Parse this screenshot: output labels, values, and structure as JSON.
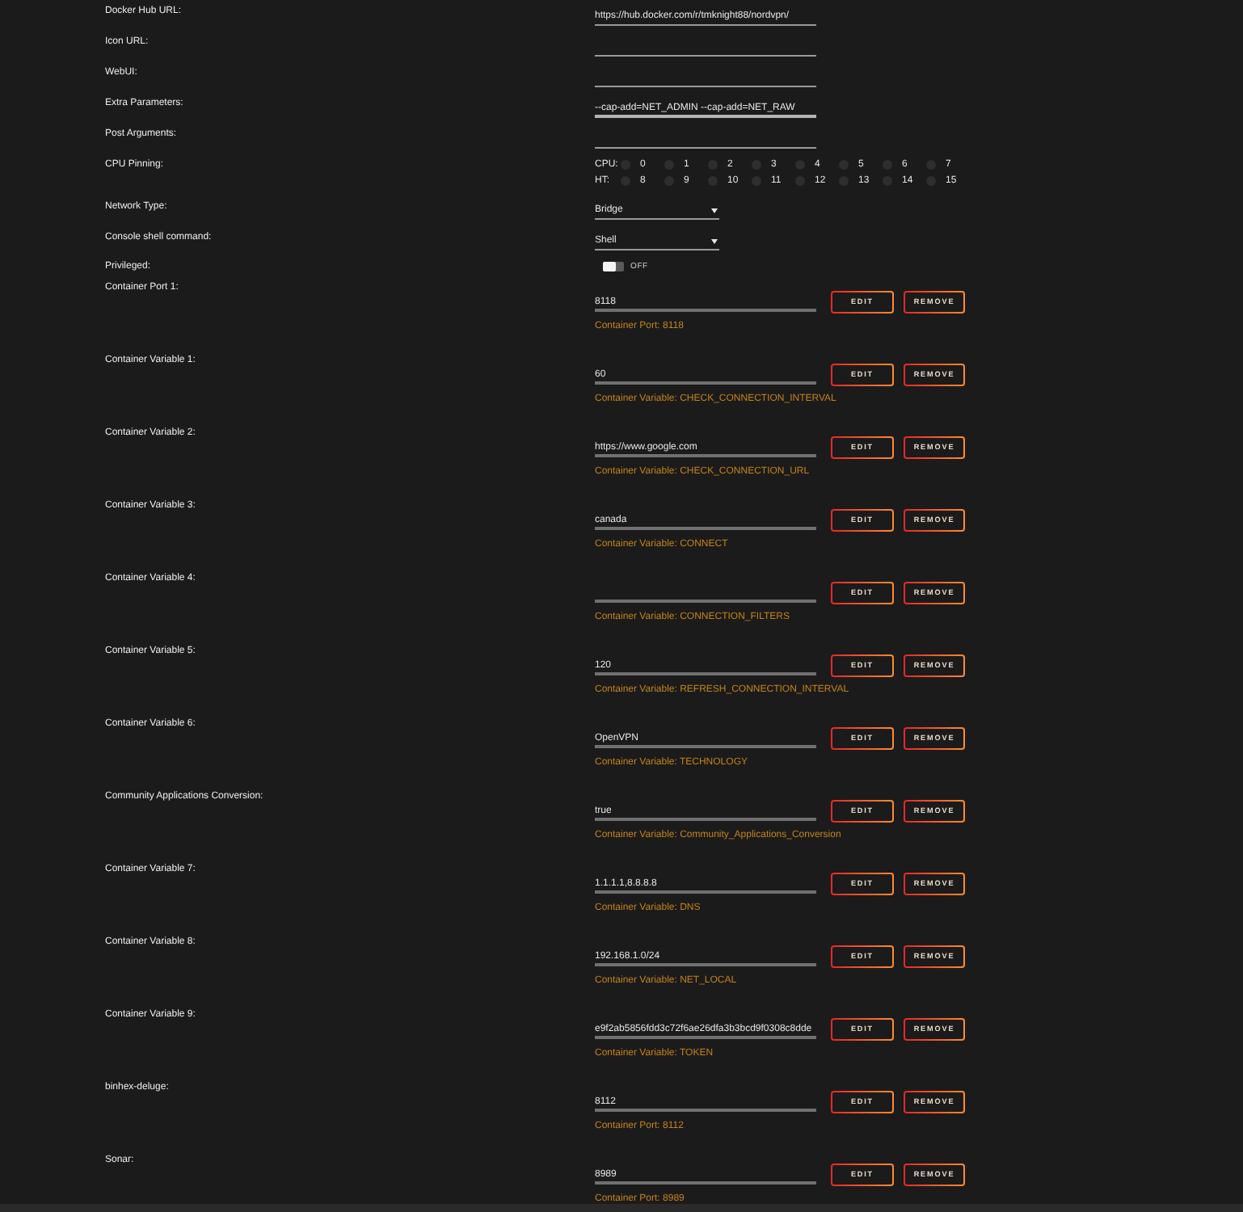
{
  "settings": [
    {
      "kind": "text",
      "label": "Docker Hub URL:",
      "value": "https://hub.docker.com/r/tmknight88/nordvpn/",
      "focused": false
    },
    {
      "kind": "text",
      "label": "Icon URL:",
      "focused": false
    },
    {
      "kind": "text",
      "label": "WebUI:",
      "focused": false
    },
    {
      "kind": "text",
      "label": "Extra Parameters:",
      "value": "--cap-add=NET_ADMIN --cap-add=NET_RAW",
      "focused": true
    },
    {
      "kind": "text",
      "label": "Post Arguments:",
      "focused": false
    },
    {
      "kind": "cpu",
      "label": "CPU Pinning:",
      "groups": [
        {
          "label": "CPU:",
          "cores": [
            {
              "number": "0",
              "checked": false
            },
            {
              "number": "1",
              "checked": false
            },
            {
              "number": "2",
              "checked": false
            },
            {
              "number": "3",
              "checked": false
            },
            {
              "number": "4",
              "checked": false
            },
            {
              "number": "5",
              "checked": false
            },
            {
              "number": "6",
              "checked": false
            },
            {
              "number": "7",
              "checked": false
            }
          ]
        },
        {
          "label": "HT:",
          "cores": [
            {
              "number": "8",
              "checked": false
            },
            {
              "number": "9",
              "checked": false
            },
            {
              "number": "10",
              "checked": false
            },
            {
              "number": "11",
              "checked": false
            },
            {
              "number": "12",
              "checked": false
            },
            {
              "number": "13",
              "checked": false
            },
            {
              "number": "14",
              "checked": false
            },
            {
              "number": "15",
              "checked": false
            }
          ]
        }
      ]
    },
    {
      "kind": "select",
      "label": "Network Type:",
      "value": "Bridge"
    },
    {
      "kind": "select",
      "label": "Console shell command:",
      "value": "Shell"
    },
    {
      "kind": "toggle",
      "label": "Privileged:",
      "on": false,
      "state_text": "OFF"
    }
  ],
  "mappings": [
    {
      "label": "Container Port 1:",
      "value": "8118",
      "edit": "EDIT",
      "remove": "REMOVE",
      "hint": "Container Port: 8118"
    },
    {
      "label": "Container Variable 1:",
      "value": "60",
      "edit": "EDIT",
      "remove": "REMOVE",
      "hint": "Container Variable: CHECK_CONNECTION_INTERVAL"
    },
    {
      "label": "Container Variable 2:",
      "value": "https://www.google.com",
      "edit": "EDIT",
      "remove": "REMOVE",
      "hint": "Container Variable: CHECK_CONNECTION_URL"
    },
    {
      "label": "Container Variable 3:",
      "value": "canada",
      "edit": "EDIT",
      "remove": "REMOVE",
      "hint": "Container Variable: CONNECT"
    },
    {
      "label": "Container Variable 4:",
      "edit": "EDIT",
      "remove": "REMOVE",
      "hint": "Container Variable: CONNECTION_FILTERS"
    },
    {
      "label": "Container Variable 5:",
      "value": "120",
      "edit": "EDIT",
      "remove": "REMOVE",
      "hint": "Container Variable: REFRESH_CONNECTION_INTERVAL"
    },
    {
      "label": "Container Variable 6:",
      "value": "OpenVPN",
      "edit": "EDIT",
      "remove": "REMOVE",
      "hint": "Container Variable: TECHNOLOGY"
    },
    {
      "label": "Community Applications Conversion:",
      "value": "true",
      "edit": "EDIT",
      "remove": "REMOVE",
      "hint": "Container Variable: Community_Applications_Conversion"
    },
    {
      "label": "Container Variable 7:",
      "value": "1.1.1.1,8.8.8.8",
      "edit": "EDIT",
      "remove": "REMOVE",
      "hint": "Container Variable: DNS"
    },
    {
      "label": "Container Variable 8:",
      "value": "192.168.1.0/24",
      "edit": "EDIT",
      "remove": "REMOVE",
      "hint": "Container Variable: NET_LOCAL"
    },
    {
      "label": "Container Variable 9:",
      "value": "e9f2ab5856fdd3c72f6ae26dfa3b3bcd9f0308c8dde",
      "edit": "EDIT",
      "remove": "REMOVE",
      "hint": "Container Variable: TOKEN"
    },
    {
      "label": "binhex-deluge:",
      "value": "8112",
      "edit": "EDIT",
      "remove": "REMOVE",
      "hint": "Container Port: 8112"
    },
    {
      "label": "Sonar:",
      "value": "8989",
      "edit": "EDIT",
      "remove": "REMOVE",
      "hint": "Container Port: 8989"
    }
  ]
}
